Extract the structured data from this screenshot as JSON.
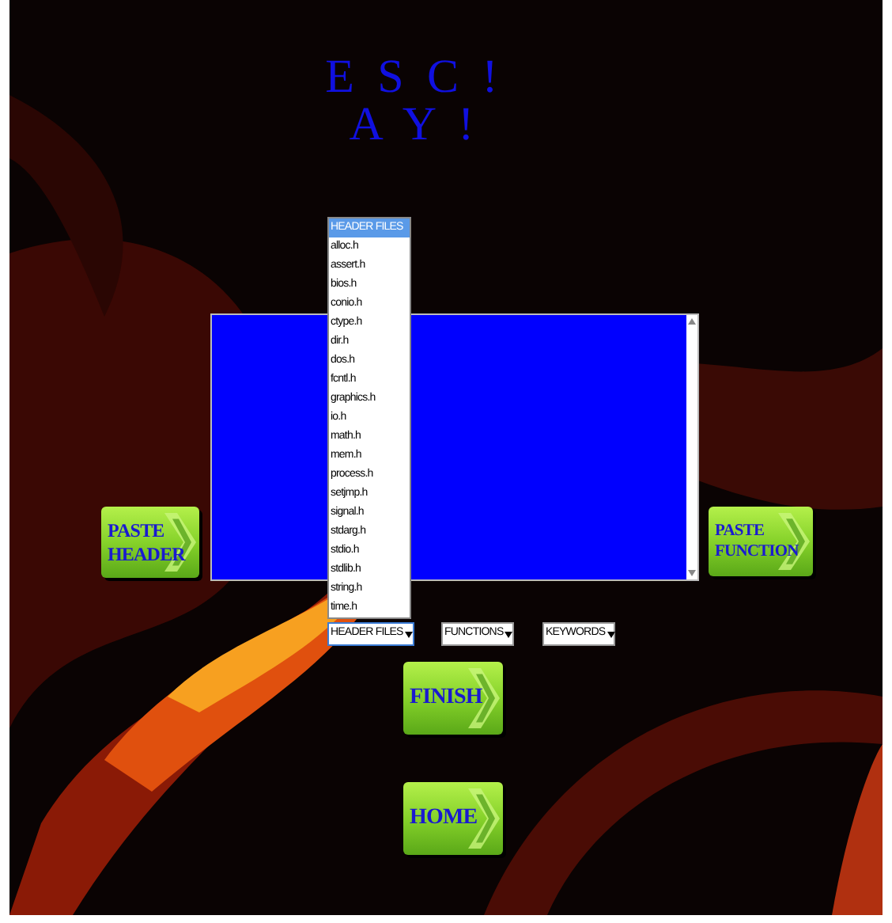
{
  "title": {
    "lines": [
      "E S C !",
      "A Y !"
    ]
  },
  "side_buttons": [
    {
      "label": "PASTE HEADER"
    },
    {
      "label": "PASTE FUNCTION"
    }
  ],
  "dropdown_list": {
    "items": [
      {
        "label": "HEADER FILES",
        "selected": true
      },
      {
        "label": "alloc.h",
        "selected": false
      },
      {
        "label": "assert.h",
        "selected": false
      },
      {
        "label": "bios.h",
        "selected": false
      },
      {
        "label": "conio.h",
        "selected": false
      },
      {
        "label": "ctype.h",
        "selected": false
      },
      {
        "label": "dir.h",
        "selected": false
      },
      {
        "label": "dos.h",
        "selected": false
      },
      {
        "label": "fcntl.h",
        "selected": false
      },
      {
        "label": "graphics.h",
        "selected": false
      },
      {
        "label": "io.h",
        "selected": false
      },
      {
        "label": "math.h",
        "selected": false
      },
      {
        "label": "mem.h",
        "selected": false
      },
      {
        "label": "process.h",
        "selected": false
      },
      {
        "label": "setjmp.h",
        "selected": false
      },
      {
        "label": "signal.h",
        "selected": false
      },
      {
        "label": "stdarg.h",
        "selected": false
      },
      {
        "label": "stdio.h",
        "selected": false
      },
      {
        "label": "stdlib.h",
        "selected": false
      },
      {
        "label": "string.h",
        "selected": false
      },
      {
        "label": "time.h",
        "selected": false
      }
    ]
  },
  "selects": [
    {
      "value": "HEADER FILES",
      "expanded": true
    },
    {
      "value": "FUNCTIONS",
      "expanded": false
    },
    {
      "value": "KEYWORDS",
      "expanded": false
    }
  ],
  "buttons": [
    {
      "label": "FINISH"
    },
    {
      "label": "HOME"
    }
  ]
}
